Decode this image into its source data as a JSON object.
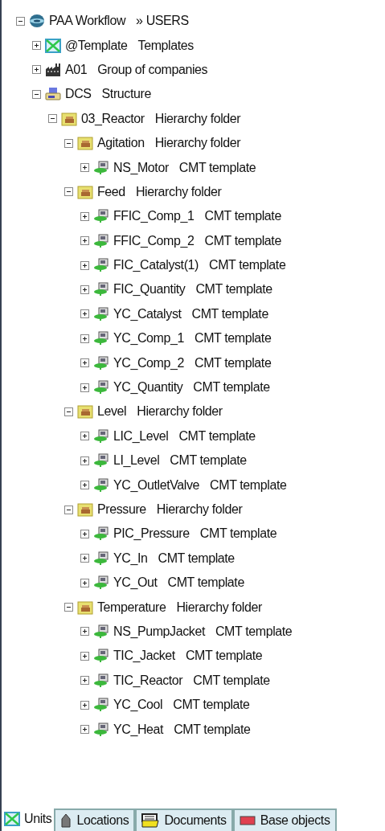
{
  "tree": [
    {
      "kind": "globe",
      "name": "PAA Workflow",
      "type": "» USERS",
      "expanded": true,
      "children": [
        {
          "kind": "units",
          "name": "@Template",
          "type": "Templates",
          "expanded": false
        },
        {
          "kind": "factory",
          "name": "A01",
          "type": "Group of companies",
          "expanded": false
        },
        {
          "kind": "structure",
          "name": "DCS",
          "type": "Structure",
          "expanded": true,
          "children": [
            {
              "kind": "folder",
              "name": "03_Reactor",
              "type": "Hierarchy folder",
              "expanded": true,
              "children": [
                {
                  "kind": "folder",
                  "name": "Agitation",
                  "type": "Hierarchy folder",
                  "expanded": true,
                  "children": [
                    {
                      "kind": "cmt",
                      "name": "NS_Motor",
                      "type": "CMT template",
                      "expanded": false
                    }
                  ]
                },
                {
                  "kind": "folder",
                  "name": "Feed",
                  "type": "Hierarchy folder",
                  "expanded": true,
                  "children": [
                    {
                      "kind": "cmt",
                      "name": "FFIC_Comp_1",
                      "type": "CMT template",
                      "expanded": false
                    },
                    {
                      "kind": "cmt",
                      "name": "FFIC_Comp_2",
                      "type": "CMT template",
                      "expanded": false
                    },
                    {
                      "kind": "cmt",
                      "name": "FIC_Catalyst(1)",
                      "type": "CMT template",
                      "expanded": false
                    },
                    {
                      "kind": "cmt",
                      "name": "FIC_Quantity",
                      "type": "CMT template",
                      "expanded": false
                    },
                    {
                      "kind": "cmt",
                      "name": "YC_Catalyst",
                      "type": "CMT template",
                      "expanded": false
                    },
                    {
                      "kind": "cmt",
                      "name": "YC_Comp_1",
                      "type": "CMT template",
                      "expanded": false
                    },
                    {
                      "kind": "cmt",
                      "name": "YC_Comp_2",
                      "type": "CMT template",
                      "expanded": false
                    },
                    {
                      "kind": "cmt",
                      "name": "YC_Quantity",
                      "type": "CMT template",
                      "expanded": false
                    }
                  ]
                },
                {
                  "kind": "folder",
                  "name": "Level",
                  "type": "Hierarchy folder",
                  "expanded": true,
                  "children": [
                    {
                      "kind": "cmt",
                      "name": "LIC_Level",
                      "type": "CMT template",
                      "expanded": false
                    },
                    {
                      "kind": "cmt",
                      "name": "LI_Level",
                      "type": "CMT template",
                      "expanded": false
                    },
                    {
                      "kind": "cmt",
                      "name": "YC_OutletValve",
                      "type": "CMT template",
                      "expanded": false
                    }
                  ]
                },
                {
                  "kind": "folder",
                  "name": "Pressure",
                  "type": "Hierarchy folder",
                  "expanded": true,
                  "children": [
                    {
                      "kind": "cmt",
                      "name": "PIC_Pressure",
                      "type": "CMT template",
                      "expanded": false
                    },
                    {
                      "kind": "cmt",
                      "name": "YC_In",
                      "type": "CMT template",
                      "expanded": false
                    },
                    {
                      "kind": "cmt",
                      "name": "YC_Out",
                      "type": "CMT template",
                      "expanded": false
                    }
                  ]
                },
                {
                  "kind": "folder",
                  "name": "Temperature",
                  "type": "Hierarchy folder",
                  "expanded": true,
                  "children": [
                    {
                      "kind": "cmt",
                      "name": "NS_PumpJacket",
                      "type": "CMT template",
                      "expanded": false
                    },
                    {
                      "kind": "cmt",
                      "name": "TIC_Jacket",
                      "type": "CMT template",
                      "expanded": false
                    },
                    {
                      "kind": "cmt",
                      "name": "TIC_Reactor",
                      "type": "CMT template",
                      "expanded": false
                    },
                    {
                      "kind": "cmt",
                      "name": "YC_Cool",
                      "type": "CMT template",
                      "expanded": false
                    },
                    {
                      "kind": "cmt",
                      "name": "YC_Heat",
                      "type": "CMT template",
                      "expanded": false
                    }
                  ]
                }
              ]
            }
          ]
        }
      ]
    }
  ],
  "tabs": [
    {
      "kind": "units",
      "label": "Units",
      "selected": true
    },
    {
      "kind": "location",
      "label": "Locations",
      "selected": false
    },
    {
      "kind": "documents",
      "label": "Documents",
      "selected": false
    },
    {
      "kind": "base",
      "label": "Base objects",
      "selected": false
    }
  ]
}
